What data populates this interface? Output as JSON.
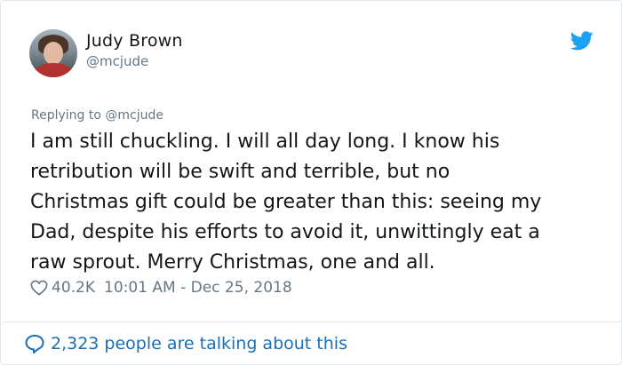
{
  "author": {
    "name": "Judy Brown",
    "handle": "@mcjude"
  },
  "reply": {
    "label": "Replying to @mcjude"
  },
  "tweet": {
    "text": "I am still chuckling. I will all day long. I know his\nretribution will be swift and terrible, but no\nChristmas gift could be greater than this: seeing my\nDad, despite his efforts to avoid it, unwittingly eat a\nraw sprout. Merry Christmas, one and all."
  },
  "meta": {
    "likes": "40.2K",
    "timestamp": "10:01 AM - Dec 25, 2018"
  },
  "footer": {
    "talking": "2,323 people are talking about this"
  },
  "icons": {
    "brand": "twitter-bird-icon",
    "like": "heart-icon",
    "talk": "speech-bubble-icon"
  },
  "colors": {
    "brand_blue": "#1da1f2",
    "link_blue": "#1b6fb3",
    "secondary_text": "#657786",
    "border": "#e1e8ed"
  }
}
